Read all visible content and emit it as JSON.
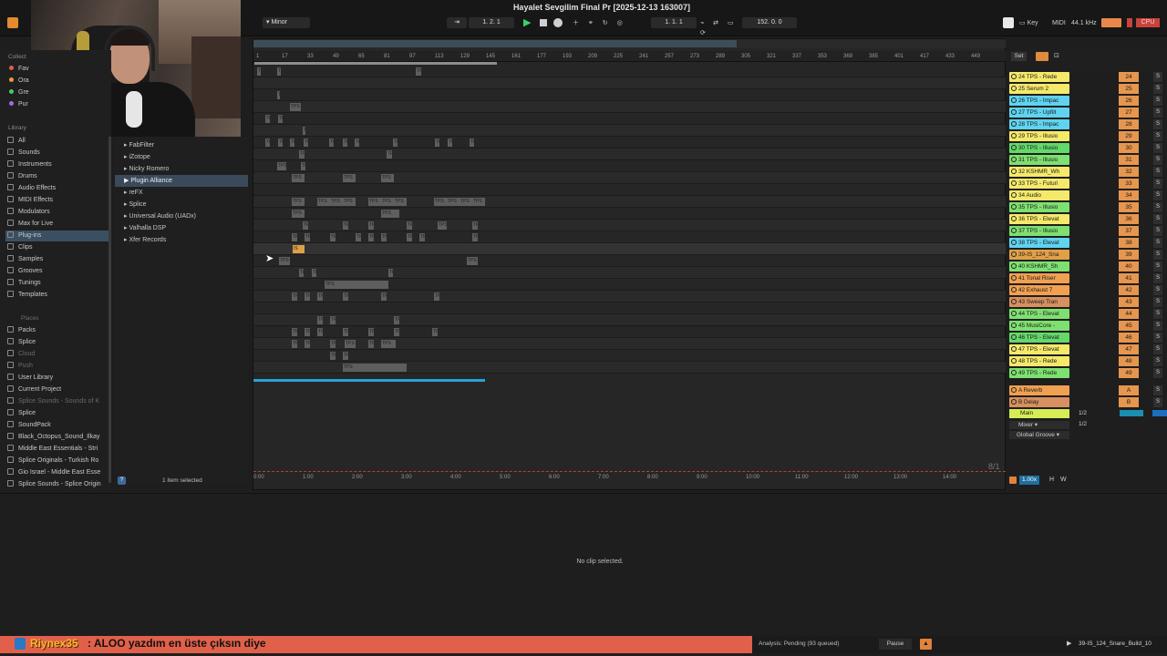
{
  "header": {
    "title": "Hayalet Sevgilim Final Pr [2025-12-13 163007]",
    "scale": "Minor",
    "bar_pos": "1.  2.  1",
    "loop_pos": "1.  1.  1",
    "tempo": "152.  0.  0",
    "key_label": "Key",
    "midi_label": "MIDI",
    "sample_rate": "44.1 kHz",
    "cpu_label": "CPU"
  },
  "browser": {
    "collections_label": "Collect",
    "favorites": [
      "Fav",
      "Ora",
      "Gre",
      "Pur"
    ],
    "library_label": "Library",
    "library_items": [
      "All",
      "Sounds",
      "Instruments",
      "Drums",
      "Audio Effects",
      "MIDI Effects",
      "Modulators",
      "Max for Live",
      "Plug-ins",
      "Clips",
      "Samples",
      "Grooves",
      "Tunings",
      "Templates"
    ],
    "selected_library": "Plug-ins",
    "places_label": "Places",
    "places_items": [
      "Packs",
      "Splice",
      "Cloud",
      "Push",
      "User Library",
      "Current Project",
      "Splice Sounds - Sounds of K",
      "Splice",
      "SoundPack",
      "Black_Octopus_Sound_Ilkay",
      "Middle East Essentials - Stri",
      "Splice Originals - Turkish Ro",
      "Gio Israel - Middle East Esse",
      "Splice Sounds - Splice Origin"
    ],
    "plugin_folders": [
      "FabFilter",
      "iZotope",
      "Nicky Romero",
      "Plugin Alliance",
      "reFX",
      "Splice",
      "Universal Audio (UADx)",
      "Valhalla DSP",
      "Xfer Records"
    ],
    "selected_folder": "Plugin Alliance",
    "status": "1 item selected",
    "help": "?"
  },
  "arrangement": {
    "ruler": [
      "1",
      "17",
      "33",
      "49",
      "65",
      "81",
      "97",
      "113",
      "129",
      "145",
      "161",
      "177",
      "193",
      "209",
      "225",
      "241",
      "257",
      "273",
      "289",
      "305",
      "321",
      "337",
      "353",
      "369",
      "385",
      "401",
      "417",
      "433",
      "449"
    ],
    "time": [
      "0:00",
      "1:00",
      "2:00",
      "3:00",
      "4:00",
      "5:00",
      "6:00",
      "7:00",
      "8:00",
      "9:00",
      "10:00",
      "11:00",
      "12:00",
      "13:00",
      "14:00"
    ],
    "clip_label": "TPS",
    "selected_clip_label": "IS",
    "meter": "8/1"
  },
  "tracks": [
    {
      "n": "24",
      "name": "24 TPS - Rede",
      "color": "#f5e96a"
    },
    {
      "n": "25",
      "name": "25 Serum 2",
      "color": "#f5e96a"
    },
    {
      "n": "26",
      "name": "26 TPS - Impac",
      "color": "#5fd3f0"
    },
    {
      "n": "27",
      "name": "27 TPS - Upfilt",
      "color": "#5fd3f0"
    },
    {
      "n": "28",
      "name": "28 TPS - Impac",
      "color": "#5fd3f0"
    },
    {
      "n": "29",
      "name": "29 TPS - Illusio",
      "color": "#f5e96a"
    },
    {
      "n": "30",
      "name": "30 TPS - Illusio",
      "color": "#64d86a"
    },
    {
      "n": "31",
      "name": "31 TPS - Illusio",
      "color": "#7ee070"
    },
    {
      "n": "32",
      "name": "32 KSHMR_Wh",
      "color": "#f5e96a"
    },
    {
      "n": "33",
      "name": "33 TPS - Futuri",
      "color": "#f5e96a"
    },
    {
      "n": "34",
      "name": "34 Audio",
      "color": "#f5e96a"
    },
    {
      "n": "35",
      "name": "35 TPS - Illusio",
      "color": "#7ee070"
    },
    {
      "n": "36",
      "name": "36 TPS - Elevat",
      "color": "#f5e96a"
    },
    {
      "n": "37",
      "name": "37 TPS - Illusio",
      "color": "#7ee070"
    },
    {
      "n": "38",
      "name": "38 TPS - Elevat",
      "color": "#5fd3f0"
    },
    {
      "n": "39",
      "name": "39-IS_124_Sna",
      "color": "#e0a048"
    },
    {
      "n": "40",
      "name": "40 KSHMR_Sh",
      "color": "#7ee070"
    },
    {
      "n": "41",
      "name": "41 Tonal Riser",
      "color": "#f0a050"
    },
    {
      "n": "42",
      "name": "42 Exhaust 7",
      "color": "#f0a050"
    },
    {
      "n": "43",
      "name": "43 Sweep Tran",
      "color": "#d89060"
    },
    {
      "n": "44",
      "name": "44 TPS - Elevat",
      "color": "#7ee070"
    },
    {
      "n": "45",
      "name": "45 MusiCore -",
      "color": "#7ee070"
    },
    {
      "n": "46",
      "name": "46 TPS - Elevat",
      "color": "#64d86a"
    },
    {
      "n": "47",
      "name": "47 TPS - Elevat",
      "color": "#f5e96a"
    },
    {
      "n": "48",
      "name": "48 TPS - Rede",
      "color": "#f5e96a"
    },
    {
      "n": "49",
      "name": "49 TPS - Rede",
      "color": "#7ee070"
    }
  ],
  "returns": [
    {
      "n": "A",
      "name": "A Reverb",
      "color": "#f0a050"
    },
    {
      "n": "B",
      "name": "B Delay",
      "color": "#d89060"
    }
  ],
  "main": {
    "name": "Main",
    "sends": "1/2",
    "mixer": "Mixer",
    "sends2": "1/2",
    "groove": "Global Groove"
  },
  "mixer_header": {
    "set": "Set"
  },
  "zoom": "1.00x",
  "hw": [
    "H",
    "W"
  ],
  "detail": {
    "empty_text": "No clip selected."
  },
  "chat": {
    "user": "Riynex35",
    "message": ": ALOO yazdım en üste çıksın diye"
  },
  "statusbar": {
    "analysis": "Analysis: Pending (93 queued)",
    "pause": "Pause",
    "current": "39-IS_124_Snare_Build_10"
  }
}
